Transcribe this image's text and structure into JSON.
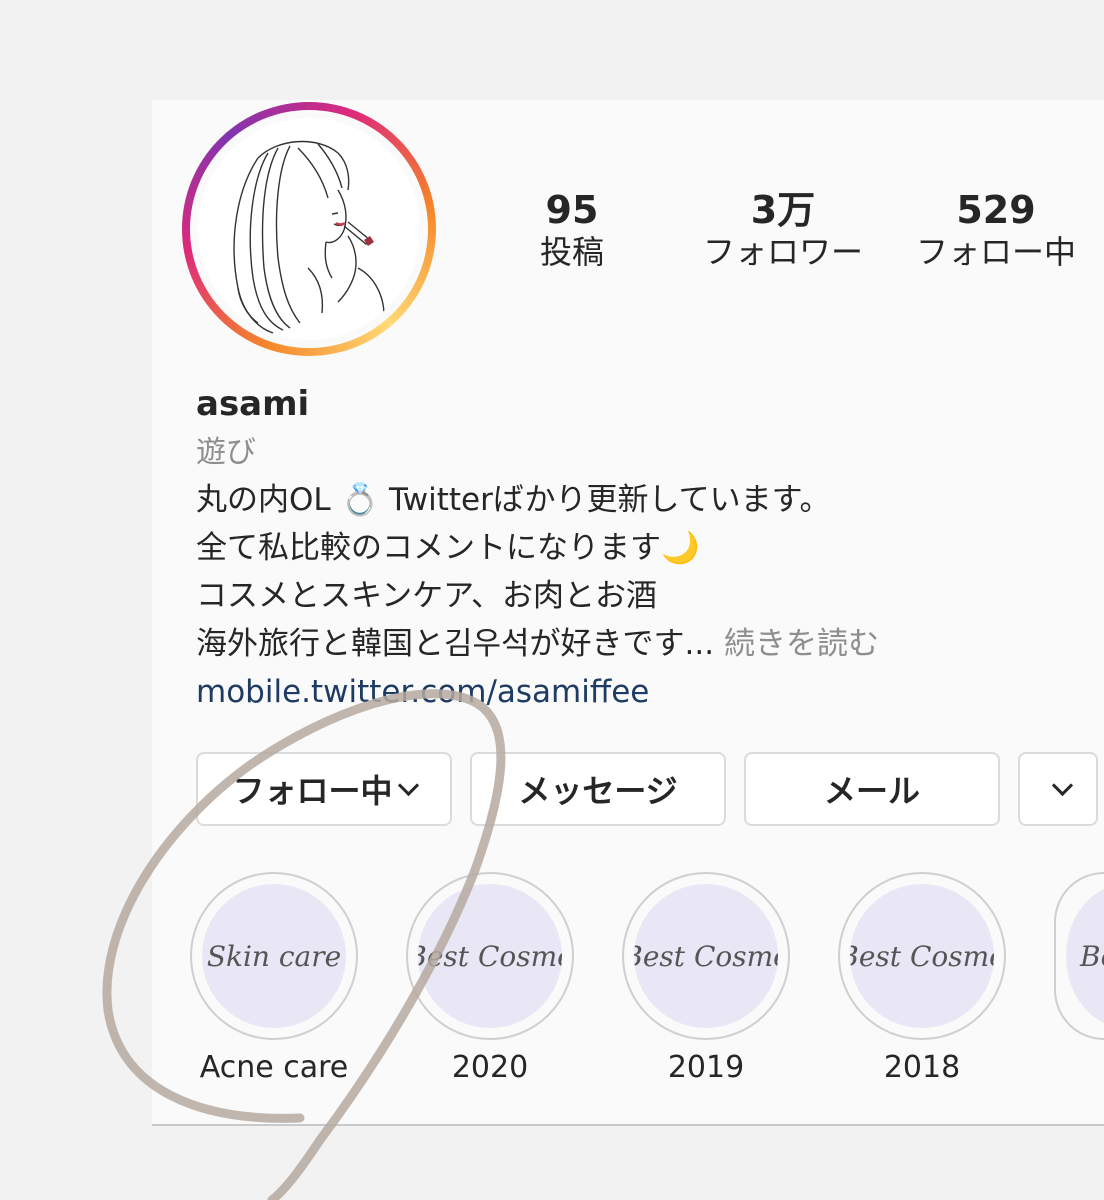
{
  "profile": {
    "username": "asami",
    "category": "遊び",
    "stats": [
      {
        "number": "95",
        "label": "投稿"
      },
      {
        "number": "3万",
        "label": "フォロワー"
      },
      {
        "number": "529",
        "label": "フォロー中"
      }
    ],
    "bio": {
      "line1": "丸の内OL 💍 Twitterばかり更新しています。",
      "line2": "全て私比較のコメントになります🌙",
      "line3": "コスメとスキンケア、お肉とお酒",
      "line4": "海外旅行と韓国と김우석が好きです...",
      "more": "続きを読む"
    },
    "link": "mobile.twitter.com/asamiffee"
  },
  "buttons": {
    "following": "フォロー中",
    "message": "メッセージ",
    "mail": "メール"
  },
  "highlights": [
    {
      "cover_text": "Skin care",
      "label": "Acne care"
    },
    {
      "cover_text": "Best Cosme",
      "label": "2020"
    },
    {
      "cover_text": "Best Cosme",
      "label": "2019"
    },
    {
      "cover_text": "Best Cosme",
      "label": "2018"
    },
    {
      "cover_text": "Bes",
      "label": ""
    }
  ],
  "colors": {
    "link": "#1d3b63",
    "muted": "#8e8e8e",
    "highlight_cover": "#e9e7f5",
    "annotation_stroke": "#b5a99f"
  },
  "icons": {
    "dropdown": "chevron-down-icon",
    "avatar": "illustrated-woman-lipstick"
  }
}
